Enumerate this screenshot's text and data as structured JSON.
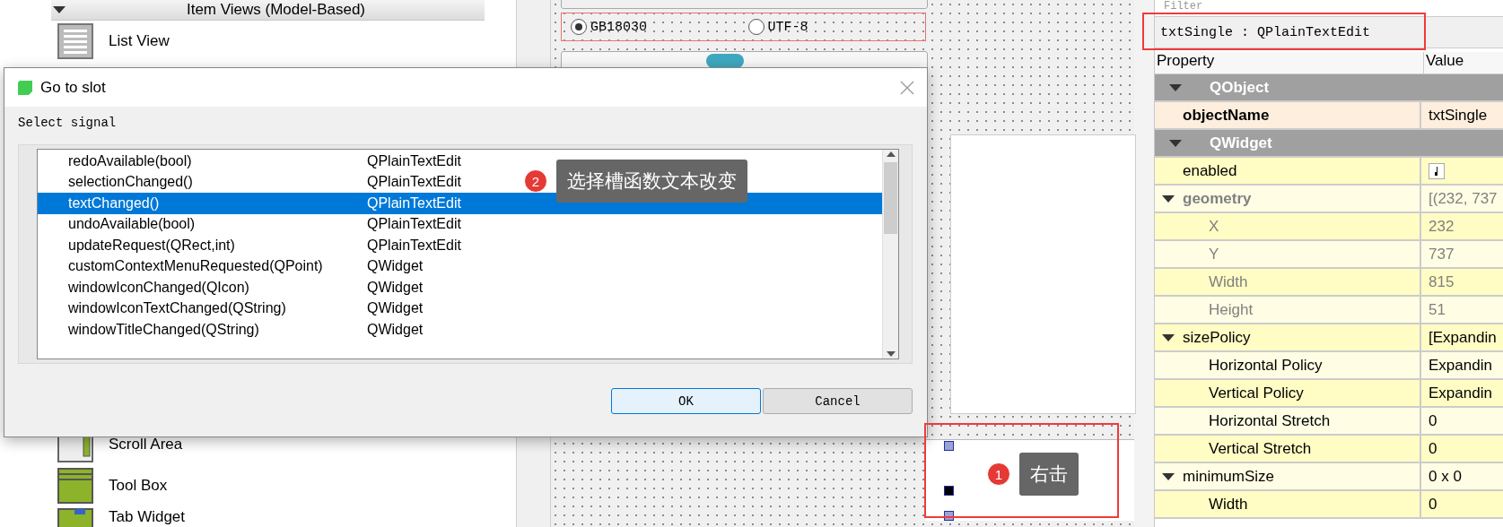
{
  "widget_box": {
    "category": "Item Views (Model-Based)",
    "top_items": [
      {
        "label": "List View"
      }
    ],
    "bottom_items": [
      {
        "label": "Scroll Area"
      },
      {
        "label": "Tool Box"
      },
      {
        "label": "Tab Widget"
      }
    ]
  },
  "form": {
    "encoding_options": [
      {
        "label": "GB18030",
        "selected": true
      },
      {
        "label": "UTF-8",
        "selected": false
      }
    ]
  },
  "property_editor": {
    "filter": {
      "placeholder": "Filter"
    },
    "object_label": "txtSingle : QPlainTextEdit",
    "columns": [
      "Property",
      "Value"
    ],
    "rows": [
      {
        "kind": "category",
        "name": "QObject",
        "expanded": true
      },
      {
        "kind": "text",
        "name": "objectName",
        "value": "txtSingle",
        "modified": true,
        "dimmed": false
      },
      {
        "kind": "category",
        "name": "QWidget",
        "expanded": true
      },
      {
        "kind": "checkbox",
        "name": "enabled",
        "checked": true,
        "modified": false,
        "dimmed": false
      },
      {
        "kind": "text",
        "name": "geometry",
        "value": "[(232, 737",
        "modified": true,
        "dimmed": true,
        "expanded": true,
        "children": [
          {
            "kind": "text",
            "name": "X",
            "value": "232",
            "modified": false,
            "dimmed": true
          },
          {
            "kind": "text",
            "name": "Y",
            "value": "737",
            "modified": false,
            "dimmed": true
          },
          {
            "kind": "text",
            "name": "Width",
            "value": "815",
            "modified": false,
            "dimmed": true
          },
          {
            "kind": "text",
            "name": "Height",
            "value": "51",
            "modified": false,
            "dimmed": true
          }
        ]
      },
      {
        "kind": "text",
        "name": "sizePolicy",
        "value": "[Expandin",
        "modified": false,
        "dimmed": false,
        "expanded": true,
        "children": [
          {
            "kind": "text",
            "name": "Horizontal Policy",
            "value": "Expandin",
            "modified": false,
            "dimmed": false
          },
          {
            "kind": "text",
            "name": "Vertical Policy",
            "value": "Expandin",
            "modified": false,
            "dimmed": false
          },
          {
            "kind": "text",
            "name": "Horizontal Stretch",
            "value": "0",
            "modified": false,
            "dimmed": false
          },
          {
            "kind": "text",
            "name": "Vertical Stretch",
            "value": "0",
            "modified": false,
            "dimmed": false
          }
        ]
      },
      {
        "kind": "text",
        "name": "minimumSize",
        "value": "0 x 0",
        "modified": false,
        "dimmed": false,
        "expanded": true,
        "children": [
          {
            "kind": "text",
            "name": "Width",
            "value": "0",
            "modified": false,
            "dimmed": false
          }
        ]
      }
    ]
  },
  "dialog": {
    "title": "Go to slot",
    "section_label": "Select signal",
    "signals": [
      {
        "name": "redoAvailable(bool)",
        "class": "QPlainTextEdit",
        "selected": false
      },
      {
        "name": "selectionChanged()",
        "class": "QPlainTextEdit",
        "selected": false
      },
      {
        "name": "textChanged()",
        "class": "QPlainTextEdit",
        "selected": true
      },
      {
        "name": "undoAvailable(bool)",
        "class": "QPlainTextEdit",
        "selected": false
      },
      {
        "name": "updateRequest(QRect,int)",
        "class": "QPlainTextEdit",
        "selected": false
      },
      {
        "name": "customContextMenuRequested(QPoint)",
        "class": "QWidget",
        "selected": false
      },
      {
        "name": "windowIconChanged(QIcon)",
        "class": "QWidget",
        "selected": false
      },
      {
        "name": "windowIconTextChanged(QString)",
        "class": "QWidget",
        "selected": false
      },
      {
        "name": "windowTitleChanged(QString)",
        "class": "QWidget",
        "selected": false
      }
    ],
    "buttons": [
      {
        "label": "OK",
        "default": true
      },
      {
        "label": "Cancel",
        "default": false
      }
    ]
  },
  "annotations": [
    {
      "number": "2",
      "text": "选择槽函数文本改变"
    },
    {
      "number": "1",
      "text": "右击"
    }
  ]
}
